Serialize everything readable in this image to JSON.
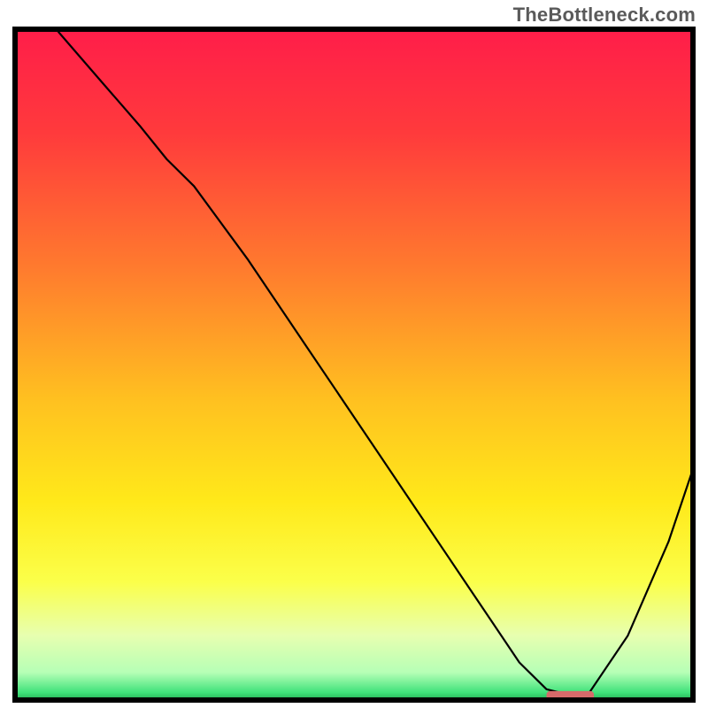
{
  "attribution": "TheBottleneck.com",
  "colors": {
    "border": "#000000",
    "attribution_text": "#5a5a5a",
    "gradient_stops": [
      {
        "offset": 0.0,
        "hex": "#ff1e49"
      },
      {
        "offset": 0.15,
        "hex": "#ff3a3c"
      },
      {
        "offset": 0.35,
        "hex": "#ff7a2e"
      },
      {
        "offset": 0.55,
        "hex": "#ffc120"
      },
      {
        "offset": 0.7,
        "hex": "#ffe91a"
      },
      {
        "offset": 0.82,
        "hex": "#fbff4a"
      },
      {
        "offset": 0.9,
        "hex": "#e7ffb0"
      },
      {
        "offset": 0.955,
        "hex": "#b6ffb6"
      },
      {
        "offset": 0.985,
        "hex": "#3fe27a"
      },
      {
        "offset": 1.0,
        "hex": "#1a9a45"
      }
    ],
    "curve": "#000000",
    "marker": "#d66a6a"
  },
  "chart_data": {
    "type": "line",
    "title": "",
    "xlabel": "",
    "ylabel": "",
    "xlim": [
      0,
      100
    ],
    "ylim": [
      0,
      100
    ],
    "axes_visible": false,
    "grid": false,
    "background": "vertical-gradient",
    "series": [
      {
        "name": "bottleneck-curve",
        "x": [
          6,
          12,
          18,
          22,
          26,
          34,
          42,
          50,
          58,
          66,
          70,
          74,
          78,
          82,
          84,
          90,
          96,
          100
        ],
        "y": [
          100,
          93,
          86,
          81,
          77,
          66,
          54,
          42,
          30,
          18,
          12,
          6,
          2,
          1,
          1,
          10,
          24,
          36
        ]
      }
    ],
    "marker": {
      "name": "optimal-point",
      "shape": "rounded-bar",
      "x_range": [
        78,
        85
      ],
      "y": 1
    },
    "notes": "Axes unlabeled; values estimated in 0–100 normalized space from pixel positions."
  }
}
